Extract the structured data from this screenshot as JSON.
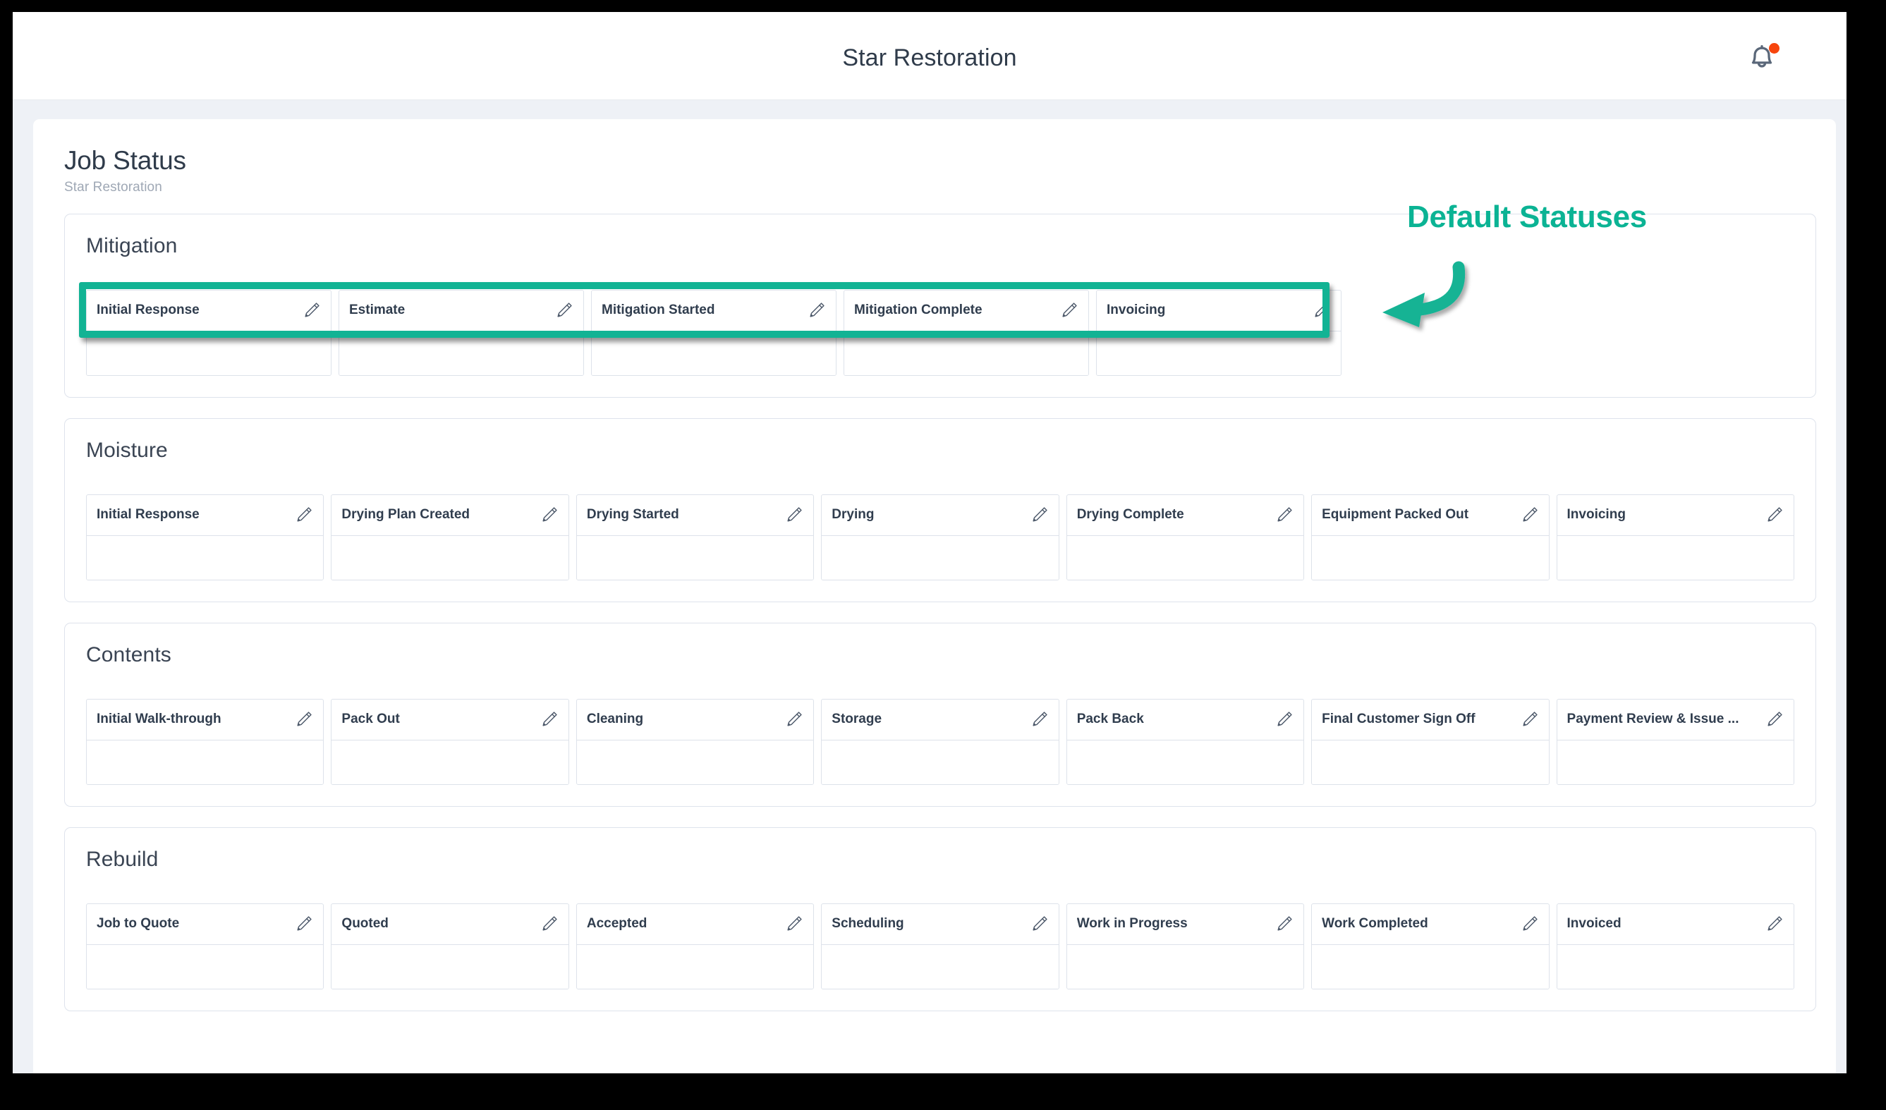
{
  "window": {
    "app_title": "Star Restoration"
  },
  "header": {
    "title": "Star Restoration",
    "notification_icon": "bell-icon",
    "has_notification_dot": true,
    "dot_color": "#f7450d"
  },
  "page": {
    "title": "Job Status",
    "subtitle": "Star Restoration"
  },
  "annotation": {
    "label": "Default Statuses",
    "color": "#0bb394",
    "arrow_icon": "curved-arrow-left-icon",
    "target": "Mitigation default status headers"
  },
  "icons": {
    "edit": "pencil-icon"
  },
  "sections": [
    {
      "title": "Mitigation",
      "highlighted": true,
      "statuses": [
        {
          "label": "Initial Response"
        },
        {
          "label": "Estimate"
        },
        {
          "label": "Mitigation Started"
        },
        {
          "label": "Mitigation Complete"
        },
        {
          "label": "Invoicing"
        }
      ]
    },
    {
      "title": "Moisture",
      "highlighted": false,
      "statuses": [
        {
          "label": "Initial Response"
        },
        {
          "label": "Drying Plan Created"
        },
        {
          "label": "Drying Started"
        },
        {
          "label": "Drying"
        },
        {
          "label": "Drying Complete"
        },
        {
          "label": "Equipment Packed Out"
        },
        {
          "label": "Invoicing"
        }
      ]
    },
    {
      "title": "Contents",
      "highlighted": false,
      "statuses": [
        {
          "label": "Initial Walk-through"
        },
        {
          "label": "Pack Out"
        },
        {
          "label": "Cleaning"
        },
        {
          "label": "Storage"
        },
        {
          "label": "Pack Back"
        },
        {
          "label": "Final Customer Sign Off"
        },
        {
          "label": "Payment Review & Issue ..."
        }
      ]
    },
    {
      "title": "Rebuild",
      "highlighted": false,
      "statuses": [
        {
          "label": "Job to Quote"
        },
        {
          "label": "Quoted"
        },
        {
          "label": "Accepted"
        },
        {
          "label": "Scheduling"
        },
        {
          "label": "Work in Progress"
        },
        {
          "label": "Work Completed"
        },
        {
          "label": "Invoiced"
        }
      ]
    }
  ]
}
